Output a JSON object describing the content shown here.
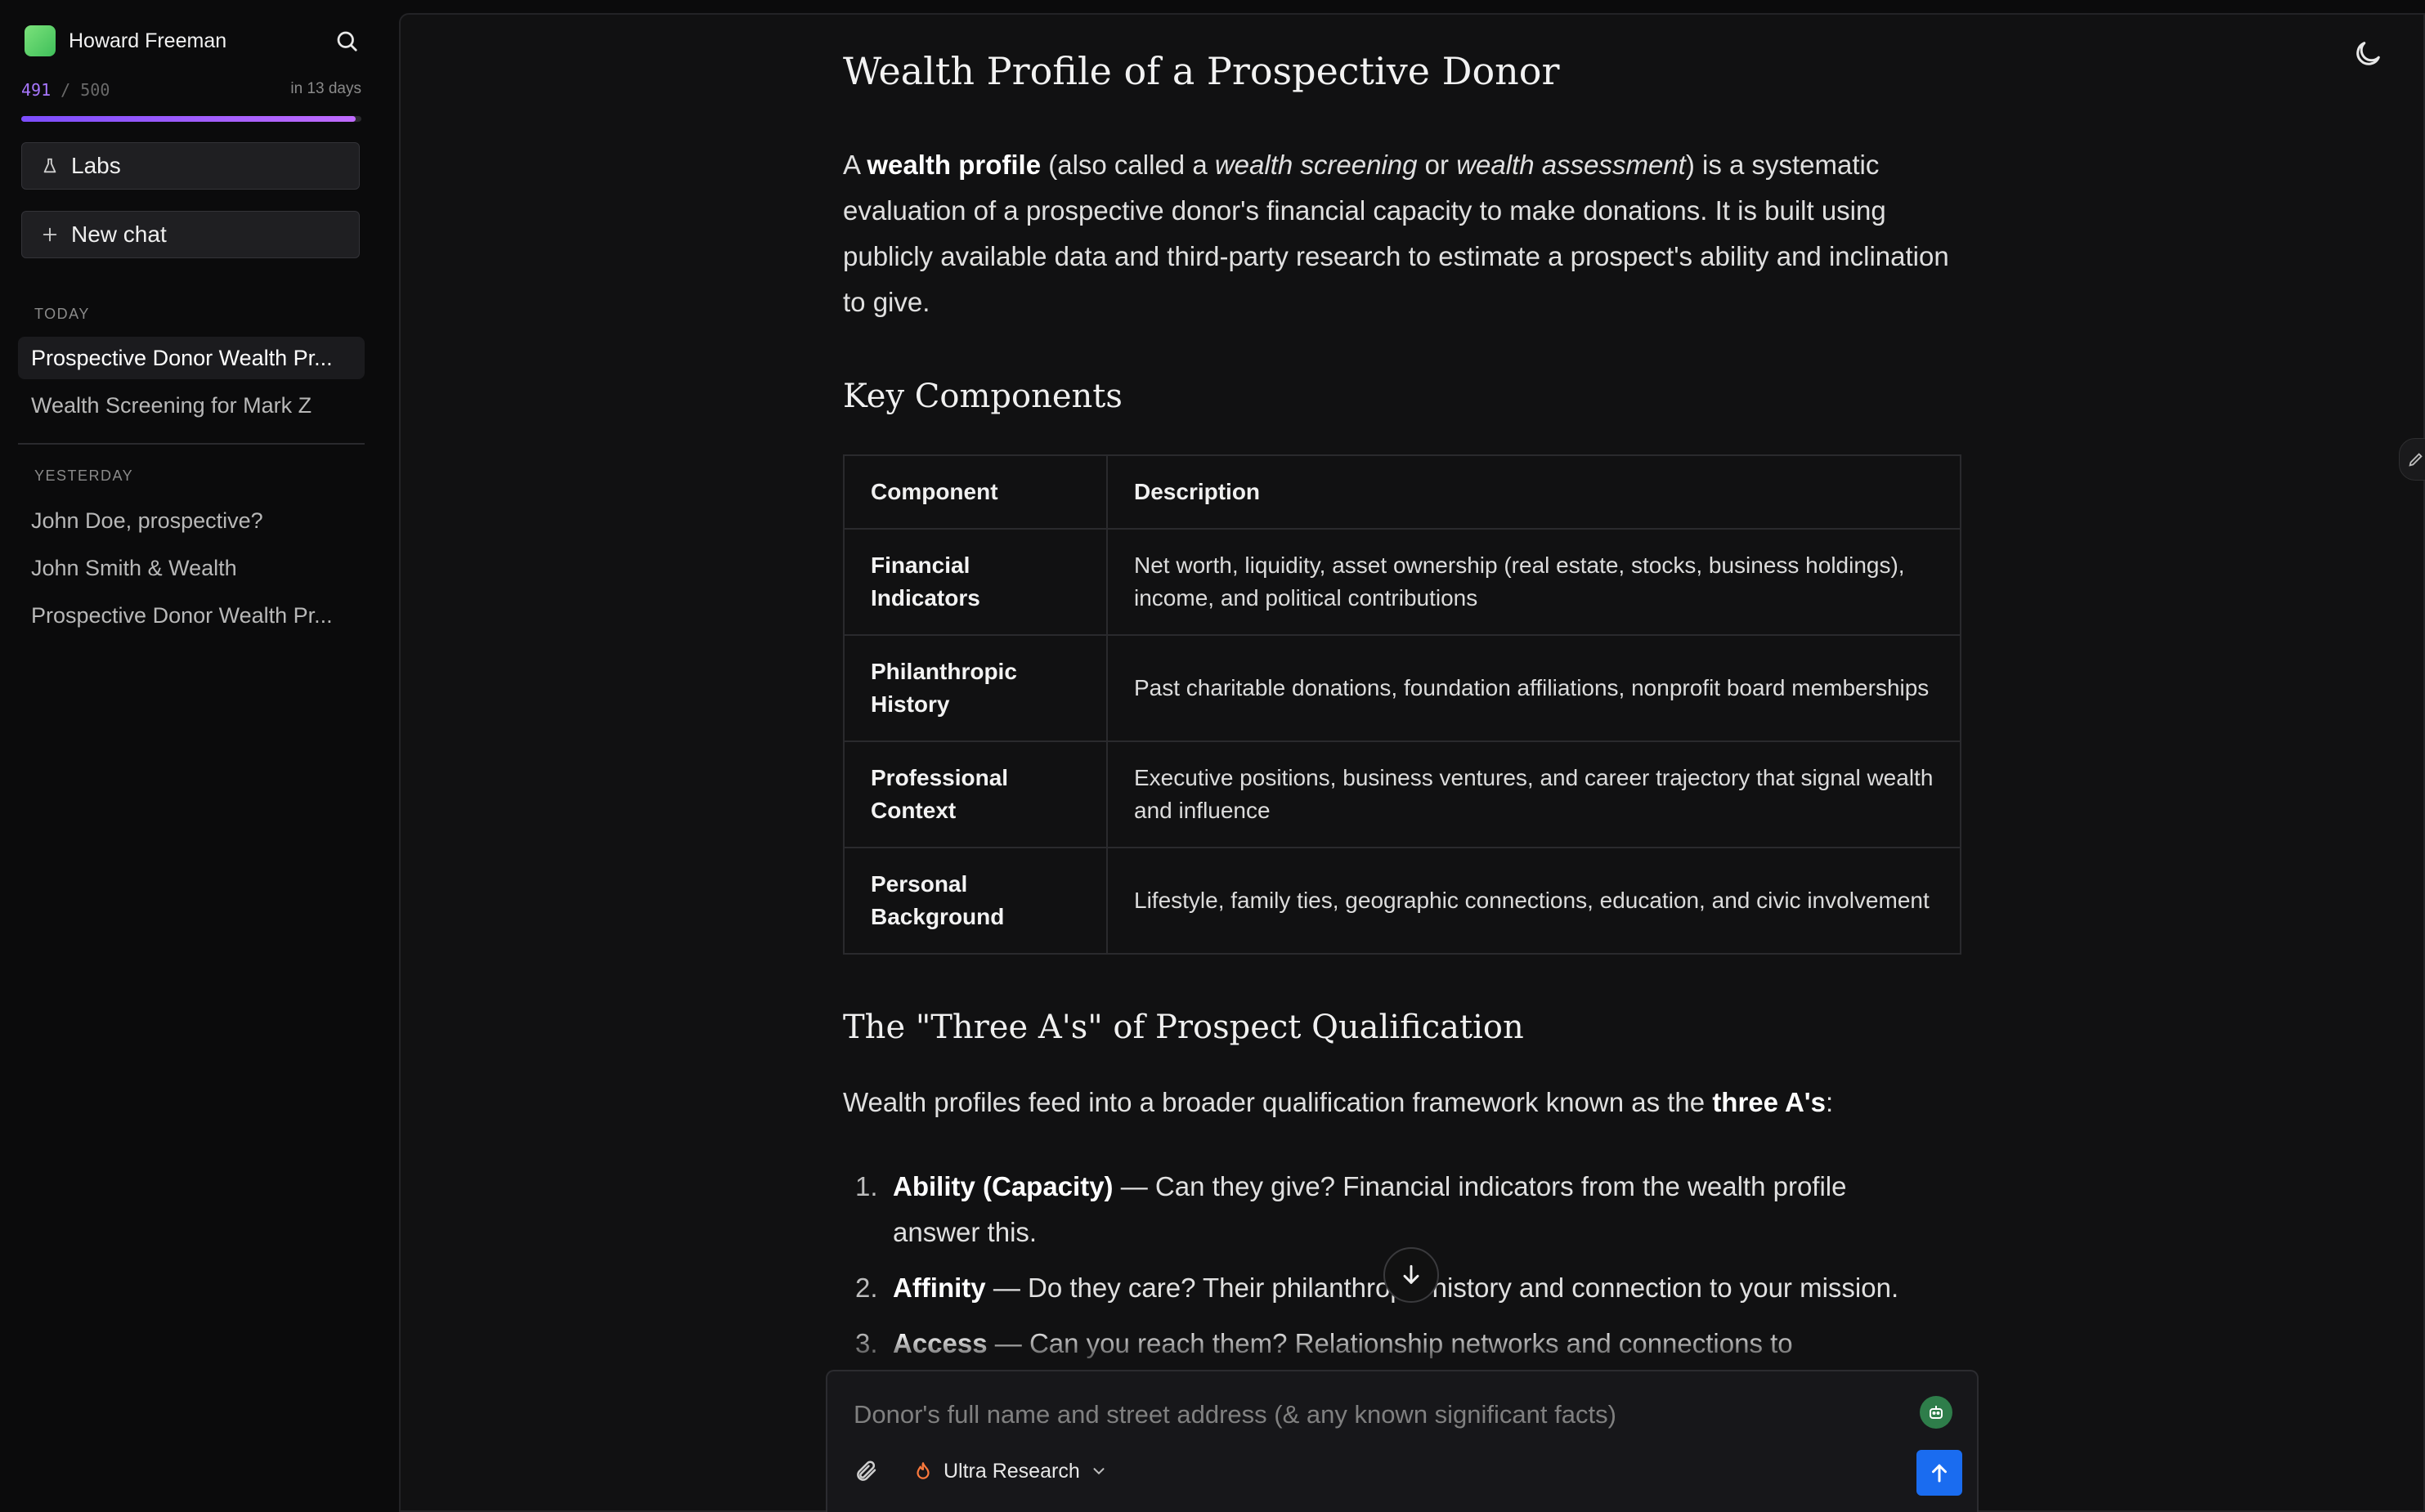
{
  "user": {
    "name": "Howard Freeman"
  },
  "usage": {
    "used": "491",
    "separator": "/",
    "limit": "500",
    "reset": "in 13 days",
    "fraction": 0.982
  },
  "sidebar": {
    "labs_label": "Labs",
    "new_chat_label": "New chat",
    "today_label": "TODAY",
    "yesterday_label": "YESTERDAY",
    "today_items": [
      {
        "label": "Prospective Donor Wealth Pr..."
      },
      {
        "label": "Wealth Screening for Mark Z"
      }
    ],
    "yesterday_items": [
      {
        "label": "John Doe, prospective?"
      },
      {
        "label": "John Smith & Wealth"
      },
      {
        "label": "Prospective Donor Wealth Pr..."
      }
    ]
  },
  "article": {
    "title": "Wealth Profile of a Prospective Donor",
    "intro": {
      "a": "A ",
      "term": "wealth profile",
      "b": " (also called a ",
      "alt1": "wealth screening",
      "c": " or ",
      "alt2": "wealth assessment",
      "d": ") is a systematic evaluation of a prospective donor's financial capacity to make donations. It is built using publicly available data and third-party research to estimate a prospect's ability and inclination to give."
    },
    "key_components_heading": "Key Components",
    "table": {
      "headers": [
        "Component",
        "Description"
      ],
      "rows": [
        {
          "k": "Financial Indicators",
          "v": "Net worth, liquidity, asset ownership (real estate, stocks, business holdings), income, and political contributions"
        },
        {
          "k": "Philanthropic History",
          "v": "Past charitable donations, foundation affiliations, nonprofit board memberships"
        },
        {
          "k": "Professional Context",
          "v": "Executive positions, business ventures, and career trajectory that signal wealth and influence"
        },
        {
          "k": "Personal Background",
          "v": "Lifestyle, family ties, geographic connections, education, and civic involvement"
        }
      ]
    },
    "three_as_heading": "The \"Three A's\" of Prospect Qualification",
    "three_as_intro_a": "Wealth profiles feed into a broader qualification framework known as the ",
    "three_as_intro_b": "three A's",
    "three_as_intro_c": ":",
    "list": [
      {
        "num": "1.",
        "term": "Ability (Capacity)",
        "text": " — Can they give? Financial indicators from the wealth profile answer this."
      },
      {
        "num": "2.",
        "term": "Affinity",
        "text": " — Do they care? Their philanthropic history and connection to your mission."
      },
      {
        "num": "3.",
        "term": "Access",
        "text": " — Can you reach them? Relationship networks and connections to"
      }
    ]
  },
  "composer": {
    "placeholder": "Donor's full name and street address (& any known significant facts)",
    "mode_label": "Ultra Research"
  },
  "colors": {
    "accent": "#a877ff",
    "send": "#1a6cf0",
    "flame": "#ff7a3d"
  }
}
